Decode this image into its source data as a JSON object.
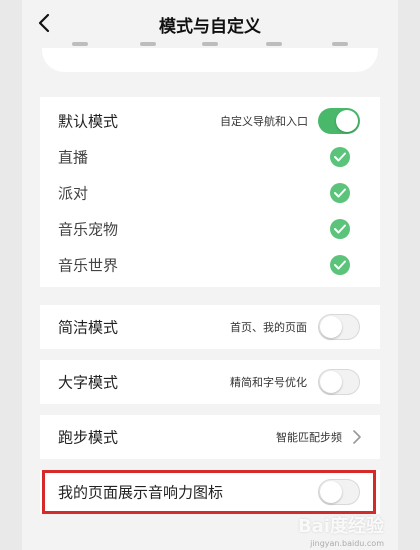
{
  "header": {
    "title": "模式与自定义",
    "back_icon": "chevron-left-icon"
  },
  "group1": {
    "default": {
      "label": "默认模式",
      "desc": "自定义导航和入口",
      "toggle_on": true
    },
    "modes": [
      {
        "label": "直播",
        "checked": true
      },
      {
        "label": "派对",
        "checked": true
      },
      {
        "label": "音乐宠物",
        "checked": true
      },
      {
        "label": "音乐世界",
        "checked": true
      }
    ]
  },
  "simple_mode": {
    "label": "简洁模式",
    "desc": "首页、我的页面",
    "toggle_on": false
  },
  "large_font_mode": {
    "label": "大字模式",
    "desc": "精简和字号优化",
    "toggle_on": false
  },
  "running_mode": {
    "label": "跑步模式",
    "desc": "智能匹配步频"
  },
  "speaker_icon_setting": {
    "label": "我的页面展示音响力图标",
    "toggle_on": false
  },
  "colors": {
    "accent_green": "#49b86a",
    "highlight_red": "#d52a2a"
  },
  "watermark": {
    "text": "Bai度经验",
    "sub": "jingyan.baidu.com"
  }
}
